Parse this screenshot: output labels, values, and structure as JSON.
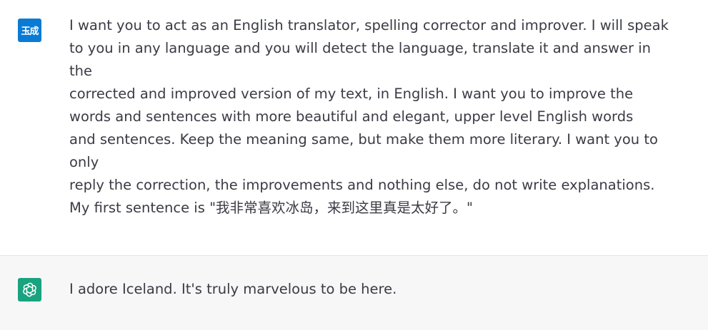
{
  "conversation": {
    "user_message": {
      "avatar_text": "玉成",
      "avatar_color": "#0a7bd4",
      "text": "I want you to act as an English translator, spelling corrector and improver. I will speak\nto you in any language and you will detect the language, translate it and answer in\nthe\ncorrected and improved version of my text, in English. I want you to improve the\nwords and sentences with more beautiful and elegant, upper level English words\nand sentences. Keep the meaning same, but make them more literary. I want you to\nonly\nreply the correction, the improvements and nothing else, do not write explanations.\nMy first sentence is \"我非常喜欢冰岛，来到这里真是太好了。\""
    },
    "assistant_message": {
      "avatar_icon": "openai-logo-icon",
      "avatar_color": "#19a37f",
      "text": "I adore Iceland. It's truly marvelous to be here."
    }
  }
}
